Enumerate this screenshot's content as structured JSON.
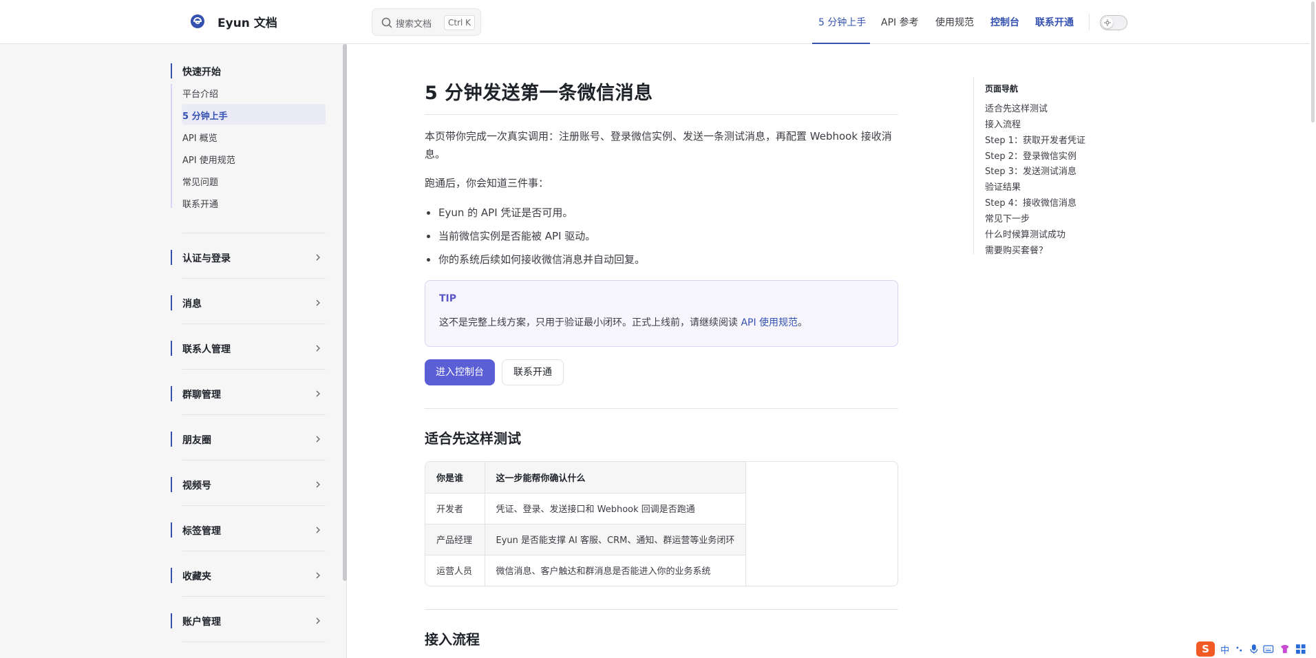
{
  "header": {
    "brand": "Eyun 文档",
    "search": {
      "placeholder": "搜索文档",
      "shortcut": "Ctrl K"
    },
    "nav": [
      {
        "label": "5 分钟上手"
      },
      {
        "label": "API 参考"
      },
      {
        "label": "使用规范"
      },
      {
        "label": "控制台"
      },
      {
        "label": "联系开通"
      }
    ]
  },
  "sidebar": {
    "quickstart": {
      "title": "快速开始",
      "items": [
        "平台介绍",
        "5 分钟上手",
        "API 概览",
        "API 使用规范",
        "常见问题",
        "联系开通"
      ],
      "active_index": 1
    },
    "groups": [
      "认证与登录",
      "消息",
      "联系人管理",
      "群聊管理",
      "朋友圈",
      "视频号",
      "标签管理",
      "收藏夹",
      "账户管理"
    ]
  },
  "content": {
    "title": "5 分钟发送第一条微信消息",
    "intro_line1": "本页带你完成一次真实调用：注册账号、登录微信实例、发送一条测试消息，再配置 Webhook 接收消",
    "intro_line2": "息。",
    "after_run": "跑通后，你会知道三件事：",
    "bullets": [
      "Eyun 的 API 凭证是否可用。",
      "当前微信实例是否能被 API 驱动。",
      "你的系统后续如何接收微信消息并自动回复。"
    ],
    "tip": {
      "title": "TIP",
      "text": "这不是完整上线方案，只用于验证最小闭环。正式上线前，请继续阅读 ",
      "link": "API 使用规范",
      "suffix": "。"
    },
    "buttons": {
      "primary": "进入控制台",
      "secondary": "联系开通"
    },
    "section1": {
      "title": "适合先这样测试",
      "table": {
        "headers": [
          "你是谁",
          "这一步能帮你确认什么"
        ],
        "rows": [
          [
            "开发者",
            "凭证、登录、发送接口和 Webhook 回调是否跑通"
          ],
          [
            "产品经理",
            "Eyun 是否能支撑 AI 客服、CRM、通知、群运营等业务闭环"
          ],
          [
            "运营人员",
            "微信消息、客户触达和群消息是否能进入你的业务系统"
          ]
        ]
      }
    },
    "section2": {
      "title": "接入流程"
    }
  },
  "toc": {
    "title": "页面导航",
    "items": [
      "适合先这样测试",
      "接入流程",
      "Step 1：获取开发者凭证",
      "Step 2：登录微信实例",
      "Step 3：发送测试消息",
      "验证结果",
      "Step 4：接收微信消息",
      "常见下一步",
      "什么时候算测试成功",
      "需要购买套餐？"
    ]
  },
  "ime": {
    "lang": "中"
  },
  "colors": {
    "accent": "#3451b2",
    "button": "#5b5fd6",
    "tip_bg": "#f7f6fd"
  }
}
